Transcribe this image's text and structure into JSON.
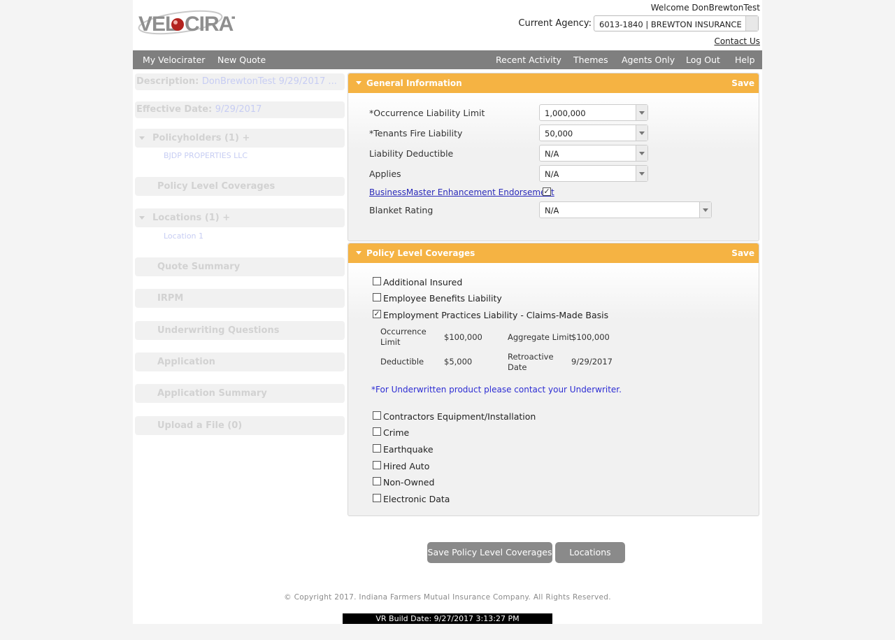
{
  "header": {
    "logo_text": "VELOCIRATER",
    "welcome": "Welcome DonBrewtonTest",
    "agency_label": "Current Agency:",
    "agency_value": "6013-1840 | BREWTON INSURANCE",
    "contact": "Contact Us"
  },
  "nav": {
    "left": [
      "My Velocirater",
      "New Quote"
    ],
    "right": [
      "Recent Activity",
      "Themes",
      "Agents Only",
      "Log Out",
      "Help"
    ]
  },
  "sidebar": {
    "description_label": "Description:",
    "description_value": "DonBrewtonTest 9/29/2017 ...",
    "effective_label": "Effective Date:",
    "effective_value": "9/29/2017",
    "policyholders": "Policyholders (1) +",
    "policyholder_name": "BJDP PROPERTIES LLC",
    "policy_level": "Policy Level Coverages",
    "locations": "Locations (1) +",
    "location_1": "Location 1",
    "quote_summary": "Quote Summary",
    "irpm": "IRPM",
    "underwriting": "Underwriting Questions",
    "application": "Application",
    "application_summary": "Application Summary",
    "upload": "Upload a File (0)"
  },
  "general": {
    "title": "General Information",
    "save": "Save",
    "occ_label": "*Occurrence Liability Limit",
    "occ_value": "1,000,000",
    "fire_label": "*Tenants Fire Liability",
    "fire_value": "50,000",
    "ded_label": "Liability Deductible",
    "ded_value": "N/A",
    "applies_label": "Applies",
    "applies_value": "N/A",
    "bme_link": "BusinessMaster Enhancement Endorsement",
    "bme_checked": "✓",
    "blanket_label": "Blanket Rating",
    "blanket_value": "N/A"
  },
  "coverages": {
    "title": "Policy Level Coverages",
    "save": "Save",
    "additional_insured": "Additional Insured",
    "employee_benefits": "Employee Benefits Liability",
    "epl": "Employment Practices Liability - Claims-Made Basis",
    "epl_checked": "✓",
    "occ_limit_label": "Occurrence Limit",
    "occ_limit_value": "$100,000",
    "agg_limit_label": "Aggregate Limit",
    "agg_limit_value": "$100,000",
    "deductible_label": "Deductible",
    "deductible_value": "$5,000",
    "retro_label": "Retroactive Date",
    "retro_value": "9/29/2017",
    "note": "*For Underwritten product please contact your Underwriter.",
    "contractors": "Contractors Equipment/Installation",
    "crime": "Crime",
    "earthquake": "Earthquake",
    "hired_auto": "Hired Auto",
    "non_owned": "Non-Owned",
    "electronic_data": "Electronic Data"
  },
  "buttons": {
    "save_policy": "Save Policy Level Coverages",
    "locations": "Locations"
  },
  "footer": {
    "copyright": "© Copyright 2017. Indiana Farmers Mutual Insurance Company. All Rights Reserved.",
    "build": "VR Build Date: 9/27/2017 3:13:27 PM"
  }
}
